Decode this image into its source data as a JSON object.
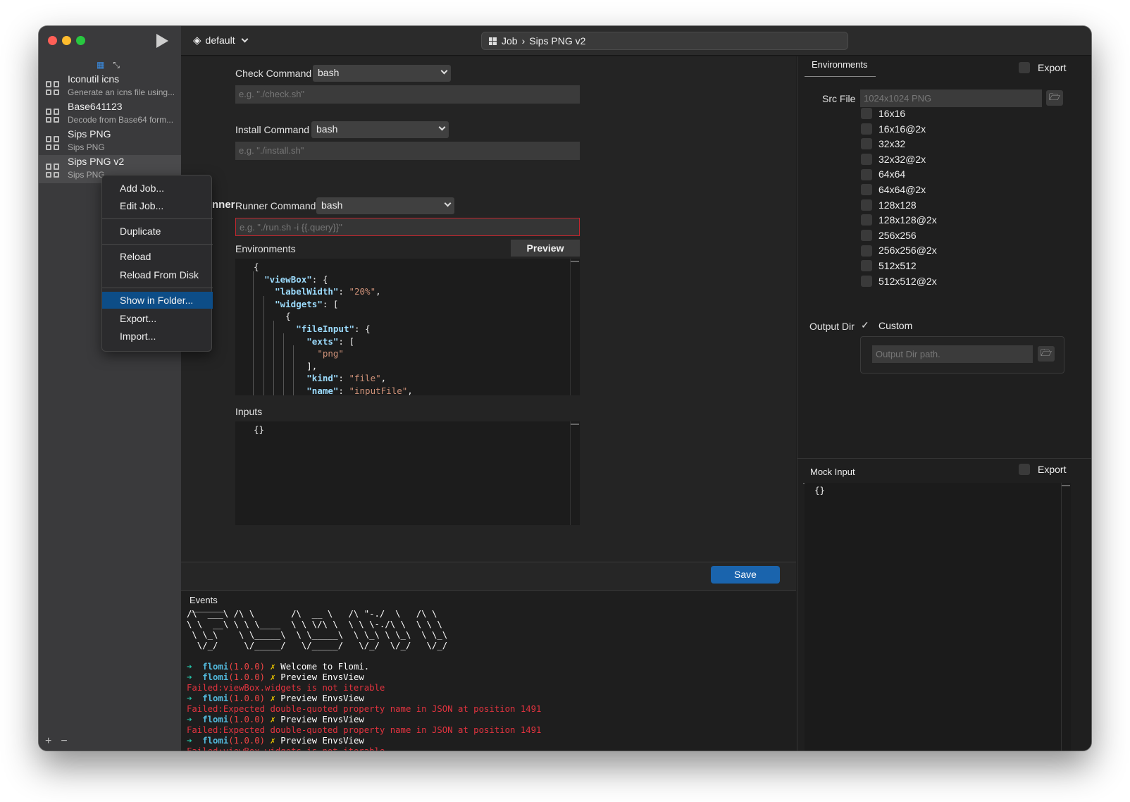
{
  "topbar": {
    "profile": "default",
    "breadcrumb": [
      "Job",
      "Sips PNG v2"
    ]
  },
  "sidebar": {
    "jobs": [
      {
        "title": "Iconutil icns",
        "subtitle": "Generate an icns file using..."
      },
      {
        "title": "Base641123",
        "subtitle": "Decode from Base64 form..."
      },
      {
        "title": "Sips PNG",
        "subtitle": "Sips PNG"
      },
      {
        "title": "Sips PNG v2",
        "subtitle": "Sips PNG"
      }
    ],
    "add": "+",
    "remove": "−"
  },
  "context_menu": {
    "add_job": "Add Job...",
    "edit_job": "Edit Job...",
    "duplicate": "Duplicate",
    "reload": "Reload",
    "reload_disk": "Reload From Disk",
    "show_folder": "Show in Folder...",
    "export": "Export...",
    "import": "Import..."
  },
  "form": {
    "check_label": "Check Command",
    "check_shell": "bash",
    "check_placeholder": "e.g. \"./check.sh\"",
    "install_label": "Install Command",
    "install_shell": "bash",
    "install_placeholder": "e.g. \"./install.sh\"",
    "section": "Runner",
    "runner_label": "Runner Command",
    "runner_shell": "bash",
    "runner_placeholder": "e.g. \"./run.sh -i {{.query}}\"",
    "env_label": "Environments",
    "preview": "Preview",
    "inputs_label": "Inputs",
    "inputs_code": "{}",
    "save": "Save"
  },
  "env_code": [
    "{",
    "  \"viewBox\": {",
    "    \"labelWidth\": \"20%\",",
    "    \"widgets\": [",
    "      {",
    "        \"fileInput\": {",
    "          \"exts\": [",
    "            \"png\"",
    "          ],",
    "          \"kind\": \"file\",",
    "          \"name\": \"inputFile\","
  ],
  "events": {
    "tab": "Events",
    "banner": [
      "/\\  ___\\ /\\ \\       /\\  __ \\   /\\ \"-./  \\   /\\ \\",
      "\\ \\  __\\ \\ \\ \\____  \\ \\ \\/\\ \\  \\ \\ \\-./\\ \\  \\ \\ \\",
      " \\ \\_\\    \\ \\_____\\  \\ \\_____\\  \\ \\_\\ \\ \\_\\  \\ \\_\\",
      "  \\/_/     \\/_____/   \\/_____/   \\/_/  \\/_/   \\/_/"
    ],
    "log": [
      {
        "type": "info",
        "arrow": "➜",
        "app": "flomi",
        "ver": "(1.0.0)",
        "mark": "✗",
        "msg": "Welcome to Flomi."
      },
      {
        "type": "info",
        "arrow": "➜",
        "app": "flomi",
        "ver": "(1.0.0)",
        "mark": "✗",
        "msg": "Preview EnvsView"
      },
      {
        "type": "fail",
        "msg": "Failed:viewBox.widgets is not iterable"
      },
      {
        "type": "info",
        "arrow": "➜",
        "app": "flomi",
        "ver": "(1.0.0)",
        "mark": "✗",
        "msg": "Preview EnvsView"
      },
      {
        "type": "fail",
        "msg": "Failed:Expected double-quoted property name in JSON at position 1491"
      },
      {
        "type": "info",
        "arrow": "➜",
        "app": "flomi",
        "ver": "(1.0.0)",
        "mark": "✗",
        "msg": "Preview EnvsView"
      },
      {
        "type": "fail",
        "msg": "Failed:Expected double-quoted property name in JSON at position 1491"
      },
      {
        "type": "info",
        "arrow": "➜",
        "app": "flomi",
        "ver": "(1.0.0)",
        "mark": "✗",
        "msg": "Preview EnvsView"
      },
      {
        "type": "fail",
        "msg": "Failed:viewBox.widgets is not iterable"
      }
    ]
  },
  "right": {
    "env_tab": "Environments",
    "export": "Export",
    "src_label": "Src File",
    "src_placeholder": "1024x1024 PNG",
    "sizes": [
      "16x16",
      "16x16@2x",
      "32x32",
      "32x32@2x",
      "64x64",
      "64x64@2x",
      "128x128",
      "128x128@2x",
      "256x256",
      "256x256@2x",
      "512x512",
      "512x512@2x"
    ],
    "output_label": "Output Dir",
    "custom": "Custom",
    "custom_checked": true,
    "output_placeholder": "Output Dir path.",
    "mock_tab": "Mock Input",
    "mock_export": "Export",
    "mock_code": "{}"
  },
  "colors": {
    "accent": "#1a64ad",
    "menu_highlight": "#0d4d87",
    "error": "#e2333f",
    "json_key": "#9cdcfe",
    "json_string": "#ce9178"
  }
}
